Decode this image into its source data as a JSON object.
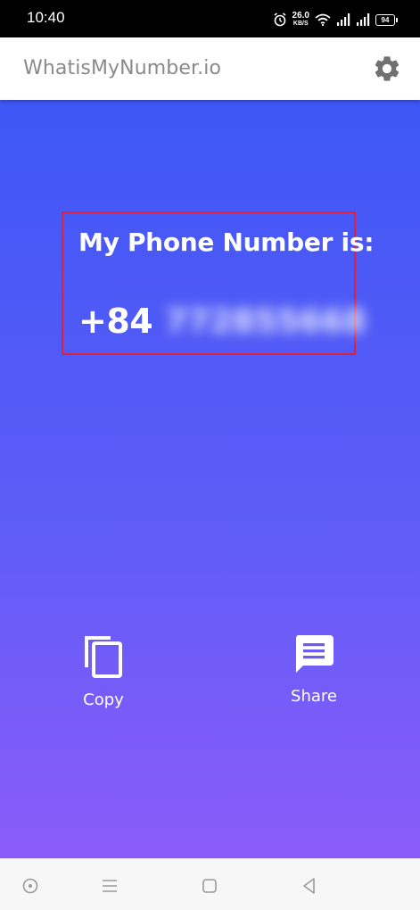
{
  "status_bar": {
    "time": "10:40",
    "network_speed": "26.0",
    "network_unit": "KB/S",
    "battery_level": "94",
    "icons": [
      "alarm-icon",
      "wifi-icon",
      "signal-icon",
      "signal-icon",
      "battery-icon"
    ]
  },
  "header": {
    "title": "WhatisMyNumber.io",
    "settings_icon": "gear-icon"
  },
  "main": {
    "label": "My Phone Number is:",
    "country_code": "+84",
    "phone_number_blurred": "772855668",
    "highlight_color": "#e0203a",
    "gradient_top": "#3d57f5",
    "gradient_bottom": "#8b5cf9",
    "actions": [
      {
        "label": "Copy",
        "icon": "copy-icon"
      },
      {
        "label": "Share",
        "icon": "share-message-icon"
      }
    ]
  },
  "nav_bar": {
    "buttons": [
      "assistant-icon",
      "menu-icon",
      "home-icon",
      "back-icon"
    ]
  }
}
